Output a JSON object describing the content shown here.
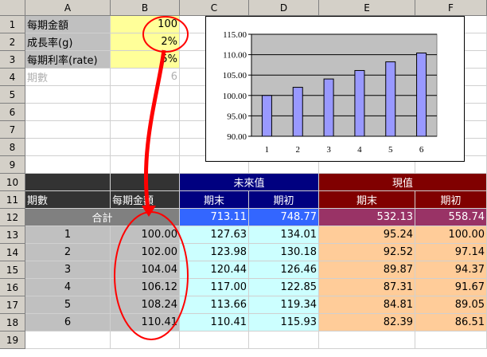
{
  "columns": [
    "A",
    "B",
    "C",
    "D",
    "E",
    "F"
  ],
  "rows": [
    "1",
    "2",
    "3",
    "4",
    "5",
    "6",
    "7",
    "8",
    "9",
    "10",
    "11",
    "12",
    "13",
    "14",
    "15",
    "16",
    "17",
    "18",
    "19"
  ],
  "params": [
    {
      "label": "每期金額",
      "value": "100"
    },
    {
      "label": "成長率(g)",
      "value": "2%"
    },
    {
      "label": "每期利率(rate)",
      "value": "5%"
    },
    {
      "label": "期數",
      "value": "6"
    }
  ],
  "table": {
    "group_future": "未來值",
    "group_present": "現值",
    "col_period": "期數",
    "col_amount": "每期金額",
    "col_end": "期末",
    "col_begin": "期初",
    "total_label": "合計",
    "totals": [
      "713.11",
      "748.77",
      "532.13",
      "558.74"
    ],
    "rows": [
      [
        "1",
        "100.00",
        "127.63",
        "134.01",
        "95.24",
        "100.00"
      ],
      [
        "2",
        "102.00",
        "123.98",
        "130.18",
        "92.52",
        "97.14"
      ],
      [
        "3",
        "104.04",
        "120.44",
        "126.46",
        "89.87",
        "94.37"
      ],
      [
        "4",
        "106.12",
        "117.00",
        "122.85",
        "87.31",
        "91.67"
      ],
      [
        "5",
        "108.24",
        "113.66",
        "119.34",
        "84.81",
        "89.05"
      ],
      [
        "6",
        "110.41",
        "110.41",
        "115.93",
        "82.39",
        "86.51"
      ]
    ]
  },
  "chart_data": {
    "type": "bar",
    "categories": [
      "1",
      "2",
      "3",
      "4",
      "5",
      "6"
    ],
    "values": [
      100.0,
      102.0,
      104.04,
      106.12,
      108.24,
      110.41
    ],
    "ylim": [
      90,
      115
    ],
    "yticks": [
      "90.00",
      "95.00",
      "100.00",
      "105.00",
      "110.00",
      "115.00"
    ],
    "grid": true,
    "bar_color": "#9999ff",
    "plot_color": "#c0c0c0"
  },
  "colors": {
    "params_fill": "#ffff99",
    "dark_header": "#333333",
    "blue_header": "#000080",
    "red_header": "#800000",
    "gray": "#c0c0c0",
    "gray_total": "#808080",
    "blue_total": "#3366ff",
    "purple_total": "#993366",
    "cyan": "#ccffff",
    "orange": "#ffcc99",
    "annotation": "#ff0000"
  }
}
